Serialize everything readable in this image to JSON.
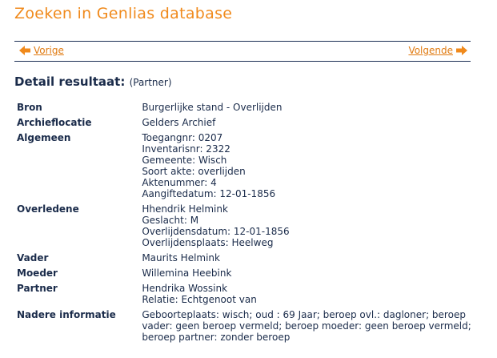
{
  "page": {
    "title": "Zoeken in Genlias database"
  },
  "nav": {
    "prev_label": "Vorige",
    "next_label": "Volgende",
    "prev_icon": "arrow-left-icon",
    "next_icon": "arrow-right-icon",
    "accent_color": "#f08a1c"
  },
  "result": {
    "heading": "Detail resultaat:",
    "subtitle": "(Partner)"
  },
  "details": [
    {
      "label": "Bron",
      "lines": [
        "Burgerlijke stand - Overlijden"
      ]
    },
    {
      "label": "Archieflocatie",
      "lines": [
        "Gelders Archief"
      ]
    },
    {
      "label": "Algemeen",
      "lines": [
        "Toegangnr: 0207",
        "Inventarisnr: 2322",
        "Gemeente: Wisch",
        "Soort akte: overlijden",
        "Aktenummer: 4",
        "Aangiftedatum: 12-01-1856"
      ]
    },
    {
      "label": "Overledene",
      "lines": [
        "Hhendrik Helmink",
        "Geslacht: M",
        "Overlijdensdatum: 12-01-1856",
        "Overlijdensplaats: Heelweg"
      ]
    },
    {
      "label": "Vader",
      "lines": [
        "Maurits Helmink"
      ]
    },
    {
      "label": "Moeder",
      "lines": [
        "Willemina Heebink"
      ]
    },
    {
      "label": "Partner",
      "lines": [
        "Hendrika Wossink",
        "Relatie: Echtgenoot van"
      ]
    },
    {
      "label": "Nadere informatie",
      "text": "Geboorteplaats: wisch; oud : 69 Jaar; beroep ovl.: dagloner; beroep vader: geen beroep vermeld; beroep moeder: geen beroep vermeld; beroep partner: zonder beroep"
    }
  ]
}
